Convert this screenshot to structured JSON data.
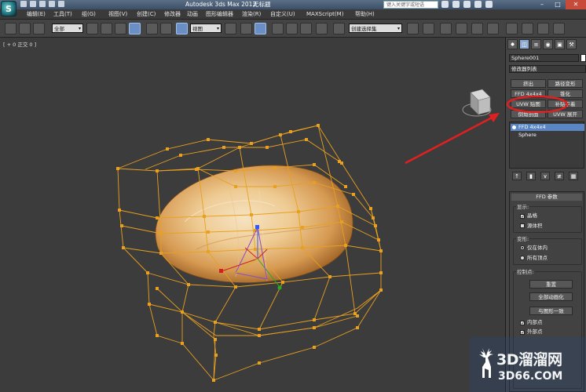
{
  "app": {
    "title": "Autodesk 3ds Max 2012",
    "doc_title": "无标题",
    "search_placeholder": "键入关键字或短语",
    "logo_letter": "S"
  },
  "menu": [
    "编辑(E)",
    "工具(T)",
    "组(G)",
    "视图(V)",
    "创建(C)",
    "修改器",
    "动画",
    "图形编辑器",
    "渲染(R)",
    "自定义(U)",
    "MAXScript(M)",
    "帮助(H)"
  ],
  "toolbar": {
    "selection_filter": "全部",
    "ref_coord": "视图",
    "named_selection": "创建选择集"
  },
  "viewport": {
    "label": "[ + 0 正交 0 ]"
  },
  "command_panel": {
    "object_name": "Sphere001",
    "modifier_list": "修改器列表",
    "modifier_buttons": [
      "挤出",
      "路径变形",
      "FFD 4x4x4",
      "锥化",
      "UVW 贴图",
      "补贴平着",
      "倒角剖面",
      "UVW 展开"
    ],
    "stack": [
      {
        "label": "FFD 4x4x4",
        "selected": true
      },
      {
        "label": "Sphere",
        "selected": false
      }
    ],
    "rollout_title": "FFD 参数",
    "display_group": "显示:",
    "display_options": [
      {
        "label": "晶格",
        "checked": true
      },
      {
        "label": "源体积",
        "checked": false
      }
    ],
    "deform_group": "变形:",
    "deform_options": [
      {
        "label": "仅在体内",
        "selected": true
      },
      {
        "label": "所有顶点",
        "selected": false
      }
    ],
    "control_group": "控制点:",
    "control_buttons": [
      "重置",
      "全部动画化",
      "与图形一致"
    ],
    "control_checks": [
      {
        "label": "内部点",
        "checked": true
      },
      {
        "label": "外部点",
        "checked": true
      }
    ]
  },
  "watermark": {
    "line1": "3D溜溜网",
    "line2": "3D66.COM"
  },
  "colors": {
    "lattice": "#e8a020",
    "annotation": "#e02020",
    "selection_blue": "#5a86c4"
  }
}
